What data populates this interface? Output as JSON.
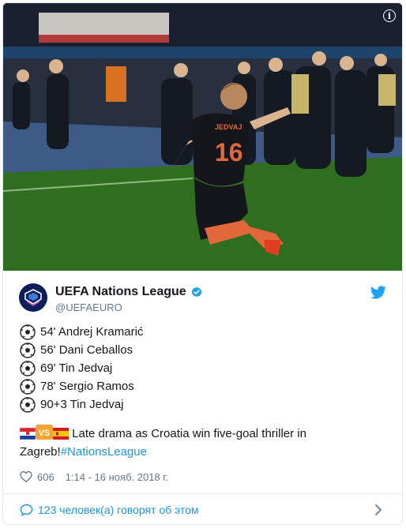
{
  "tweet": {
    "author": {
      "display_name": "UEFA Nations League",
      "handle": "@UEFAEURO",
      "verified": true
    },
    "goals": [
      {
        "text": "54' Andrej Kramarić"
      },
      {
        "text": "56' Dani Ceballos"
      },
      {
        "text": "69' Tin Jedvaj"
      },
      {
        "text": "78' Sergio Ramos"
      },
      {
        "text": "90+3 Tin Jedvaj"
      }
    ],
    "text_main": " Late drama as Croatia win five-goal thriller in Zagreb!",
    "hashtag": "#NationsLeague",
    "vs_label": "VS",
    "likes": "606",
    "timestamp": "1:14 - 16 нояб. 2018 г.",
    "conversation_label": "123 человек(а) говорят об этом",
    "player_name_on_shirt": "JEDVAJ",
    "player_number": "16"
  },
  "icons": {
    "info": "info-icon",
    "verified": "verified-badge-icon",
    "brand": "twitter-bird-icon",
    "goal": "soccer-ball-icon",
    "like": "heart-icon",
    "reply": "speech-bubble-icon",
    "more": "chevron-right-icon"
  },
  "colors": {
    "link": "#1b95e0",
    "secondary_text": "#657786",
    "border": "#e1e8ed",
    "verified": "#1da1f2"
  }
}
